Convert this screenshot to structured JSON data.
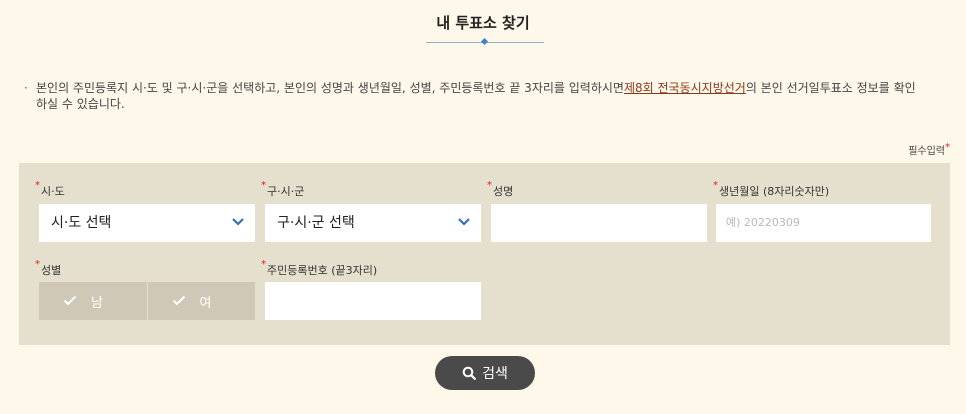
{
  "page": {
    "title": "내 투표소 찾기",
    "notice_bullet": "·",
    "notice_text_1": "본인의 주민등록지 시·도 및 구·시·군을 선택하고, 본인의 성명과 생년월일, 성별, 주민등록번호 끝 3자리를 입력하시면",
    "notice_link": "제8회 전국동시지방선거",
    "notice_text_2": "의 본인 선거일투표소 정보를 확인하실 수 있습니다.",
    "required_label": "필수입력",
    "required_star": "*"
  },
  "form": {
    "sido": {
      "label": "시·도",
      "value": "시·도 선택"
    },
    "gusigun": {
      "label": "구·시·군",
      "value": "구·시·군 선택"
    },
    "name": {
      "label": "성명",
      "value": ""
    },
    "birth": {
      "label": "생년월일 (8자리숫자만)",
      "placeholder": "예) 20220309"
    },
    "gender": {
      "label": "성별",
      "options": [
        "남",
        "여"
      ]
    },
    "rrn": {
      "label": "주민등록번호 (끝3자리)",
      "value": ""
    }
  },
  "search": {
    "label": "검색"
  },
  "colors": {
    "accent": "#3e83cc",
    "link": "#8b3a1a",
    "required": "#e0201a",
    "panel": "#e5dfcd",
    "button": "#4a4a4a"
  },
  "icons": [
    "chevron-down-icon",
    "check-icon",
    "search-icon"
  ]
}
